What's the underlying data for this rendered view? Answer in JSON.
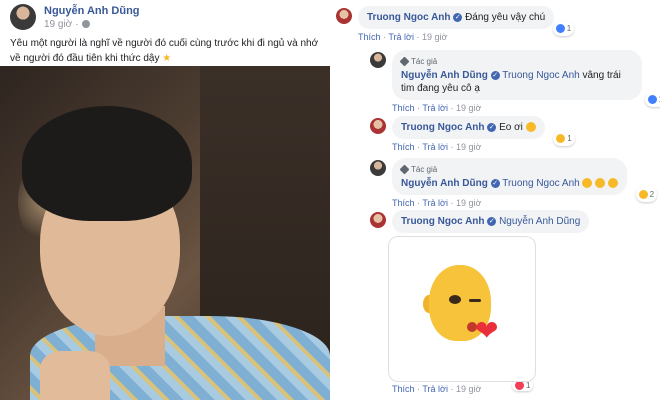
{
  "post": {
    "author": "Nguyễn Anh Dũng",
    "time": "19 giờ",
    "caption": "Yêu một người là nghĩ về người đó cuối cùng trước khi đi ngủ và nhớ về người đó đầu tiên khi thức dậy",
    "caption_emoji": "★",
    "photo_label": ""
  },
  "labels": {
    "like": "Thích",
    "reply": "Trả lời",
    "author_badge": "Tác giả",
    "sep": "·"
  },
  "comments": [
    {
      "name": "Truong Ngoc Anh",
      "text": "Đáng yêu vậy chú",
      "time": "19 giờ",
      "reaction_count": "1"
    },
    {
      "name": "Nguyễn Anh Dũng",
      "mention": "Truong Ngoc Anh",
      "text": "vâng trái tim đang yêu cô ạ",
      "time": "19 giờ",
      "reaction_count": "1"
    },
    {
      "name": "Truong Ngoc Anh",
      "text": "Eo ơi",
      "time": "19 giờ",
      "reaction_count": "1"
    },
    {
      "name": "Nguyễn Anh Dũng",
      "mention": "Truong Ngoc Anh",
      "text": "",
      "time": "19 giờ",
      "reaction_count": "2"
    },
    {
      "name": "Truong Ngoc Anh",
      "mention": "Nguyễn Anh Dũng",
      "text": "",
      "time": "19 giờ",
      "reaction_count": "1"
    }
  ],
  "colors": {
    "link": "#385898",
    "bubble": "#f2f3f5",
    "meta": "#90949c",
    "like": "#4080ff",
    "love": "#f33e58",
    "haha": "#f7b928"
  }
}
